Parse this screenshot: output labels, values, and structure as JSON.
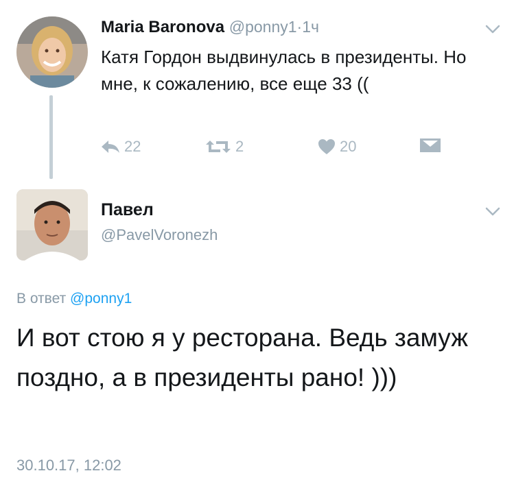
{
  "tweet1": {
    "author_name": "Maria Baronova",
    "handle": "@ponny1",
    "separator": "·",
    "time": "1ч",
    "text": "Катя Гордон выдвинулась в президенты. Но мне, к сожалению, все еще 33 ((",
    "reply_count": "22",
    "retweet_count": "2",
    "like_count": "20"
  },
  "tweet2": {
    "author_name": "Павел",
    "handle": "@PavelVoronezh",
    "reply_prefix": "В ответ",
    "reply_to": "@ponny1",
    "text": "И вот стою я у ресторана.  Ведь замуж поздно, а в президенты рано! )))",
    "timestamp": "30.10.17, 12:02"
  },
  "icons": {
    "reply": "reply-icon",
    "retweet": "retweet-icon",
    "like": "heart-icon",
    "dm": "envelope-icon",
    "more": "chevron-down-icon"
  },
  "colors": {
    "muted": "#8899a6",
    "icon": "#aab8c2",
    "link": "#1da1f2",
    "text": "#14171a"
  }
}
